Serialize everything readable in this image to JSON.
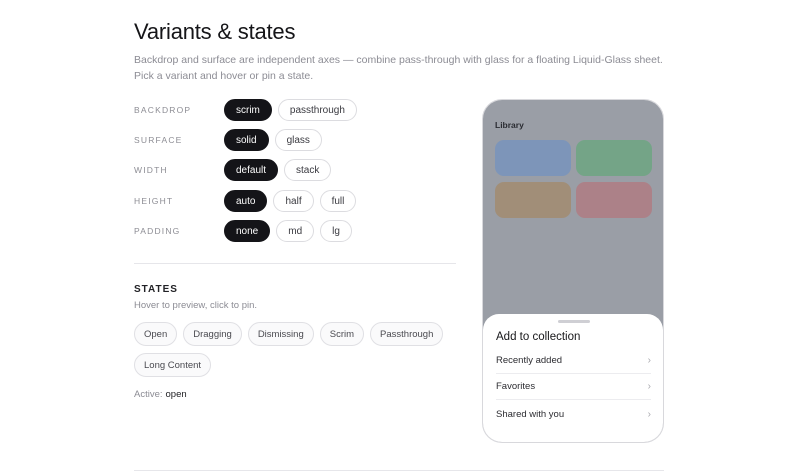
{
  "header": {
    "title": "Variants & states",
    "description": "Backdrop and surface are independent axes — combine pass-through with glass for a floating Liquid-Glass sheet. Pick a variant and hover or pin a state."
  },
  "variants": [
    {
      "label": "BACKDROP",
      "options": [
        "scrim",
        "passthrough"
      ],
      "selected": "scrim"
    },
    {
      "label": "SURFACE",
      "options": [
        "solid",
        "glass"
      ],
      "selected": "solid"
    },
    {
      "label": "WIDTH",
      "options": [
        "default",
        "stack"
      ],
      "selected": "default"
    },
    {
      "label": "HEIGHT",
      "options": [
        "auto",
        "half",
        "full"
      ],
      "selected": "auto"
    },
    {
      "label": "PADDING",
      "options": [
        "none",
        "md",
        "lg"
      ],
      "selected": "none"
    }
  ],
  "states": {
    "title": "STATES",
    "hint": "Hover to preview, click to pin.",
    "chips": [
      "Open",
      "Dragging",
      "Dismissing",
      "Scrim",
      "Passthrough",
      "Long Content"
    ],
    "active_label": "Active:",
    "active_value": "open"
  },
  "preview": {
    "screen_title": "Library",
    "tile_colors": [
      "#7d95b9",
      "#74a487",
      "#a18e78",
      "#ac8188"
    ],
    "sheet": {
      "title": "Add to collection",
      "items": [
        "Recently added",
        "Favorites",
        "Shared with you"
      ]
    }
  },
  "colors": {
    "accent": "#141418",
    "scrim": "#9a9ea6"
  }
}
